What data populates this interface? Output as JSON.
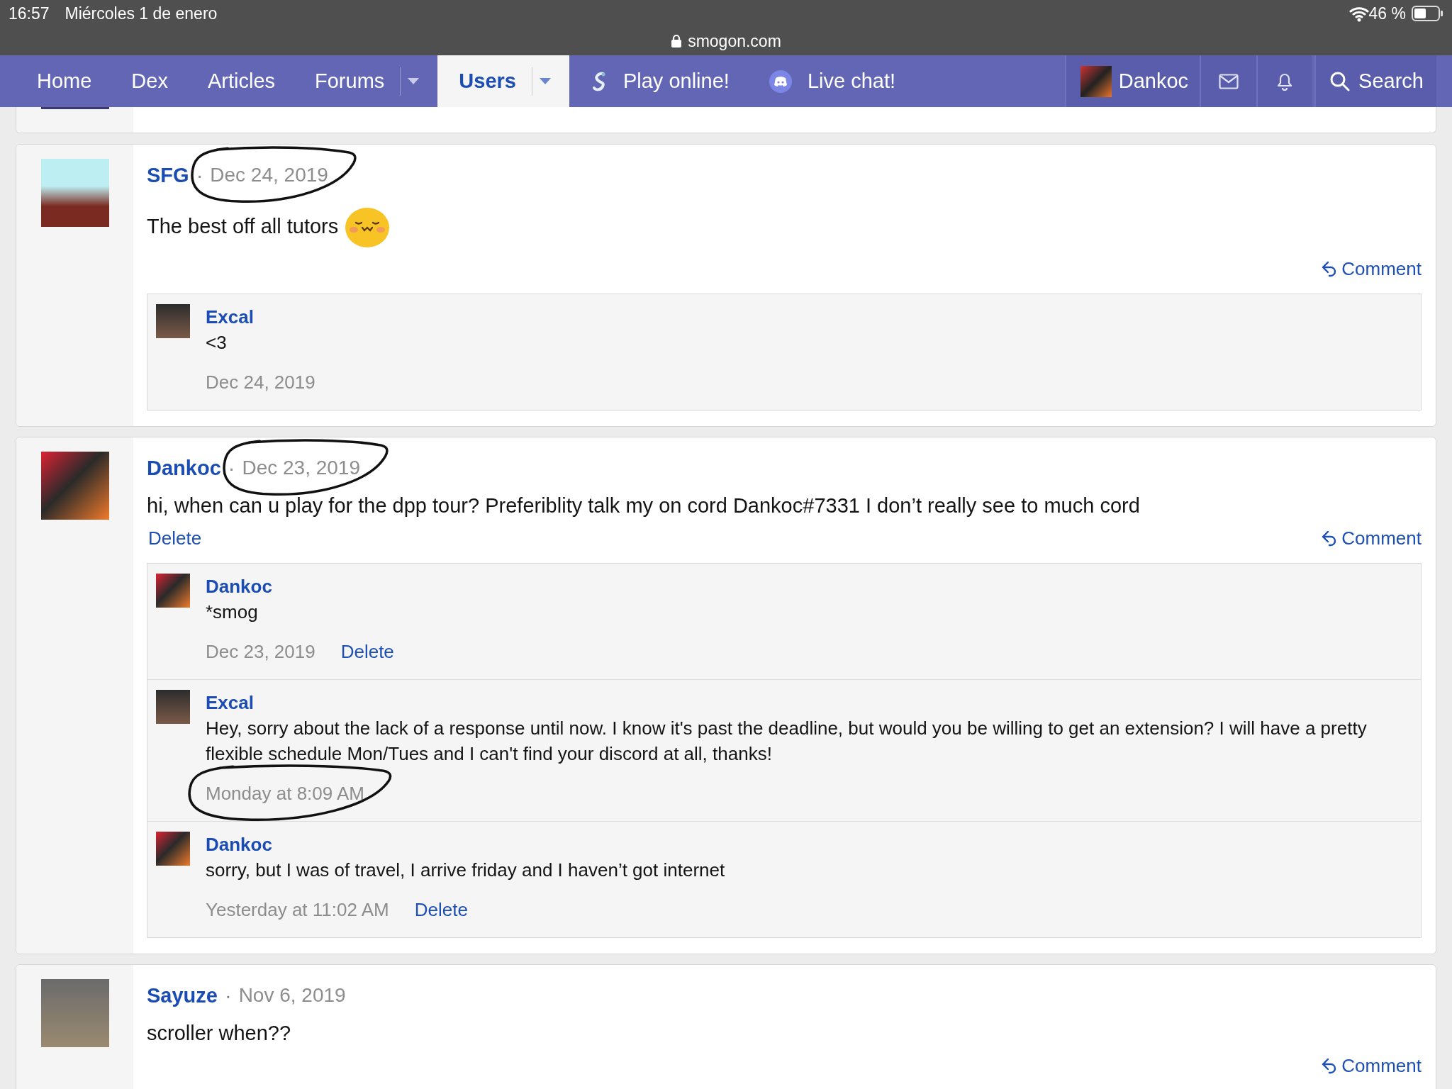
{
  "status_bar": {
    "time": "16:57",
    "date": "Miércoles 1 de enero",
    "battery": "46 %",
    "url": "smogon.com"
  },
  "nav": {
    "items": [
      {
        "label": "Home",
        "selected": false,
        "dropdown": false,
        "kind": "text"
      },
      {
        "label": "Dex",
        "selected": false,
        "dropdown": false,
        "kind": "text"
      },
      {
        "label": "Articles",
        "selected": false,
        "dropdown": false,
        "kind": "text"
      },
      {
        "label": "Forums",
        "selected": false,
        "dropdown": true,
        "kind": "text"
      },
      {
        "label": "Users",
        "selected": true,
        "dropdown": true,
        "kind": "text"
      },
      {
        "label": "Play online!",
        "selected": false,
        "dropdown": false,
        "kind": "play"
      },
      {
        "label": "Live chat!",
        "selected": false,
        "dropdown": false,
        "kind": "chat"
      }
    ],
    "user": "Dankoc",
    "search": "Search"
  },
  "posts": [
    {
      "author": "SFG",
      "separator": "·",
      "date": "Dec 24, 2019",
      "circled": true,
      "text": "The best off all tutors",
      "emoji": true,
      "comment": "Comment",
      "comments": [
        {
          "author": "Excal",
          "text": "<3",
          "date": "Dec 24, 2019",
          "circled": false
        }
      ]
    },
    {
      "author": "Dankoc",
      "separator": "·",
      "date": "Dec 23, 2019",
      "circled": true,
      "text": "hi, when can u play for the dpp tour? Preferiblity talk my on cord Dankoc#7331 I don’t really see to much cord",
      "delete": "Delete",
      "comment": "Comment",
      "comments": [
        {
          "author": "Dankoc",
          "text": "*smog",
          "date": "Dec 23, 2019",
          "delete": "Delete",
          "circled": false
        },
        {
          "author": "Excal",
          "text": "Hey, sorry about the lack of a response until now. I know it's past the deadline, but would you be willing to get an extension? I will have a pretty flexible schedule Mon/Tues and I can't find your discord at all, thanks!",
          "date": "Monday at 8:09 AM",
          "circled": true
        },
        {
          "author": "Dankoc",
          "text": "sorry, but I was of travel, I arrive friday and I haven’t got internet",
          "date": "Yesterday at 11:02 AM",
          "delete": "Delete",
          "circled": false
        }
      ]
    },
    {
      "author": "Sayuze",
      "separator": "·",
      "date": "Nov 6, 2019",
      "circled": false,
      "text": "scroller when??",
      "comment": "Comment"
    }
  ]
}
